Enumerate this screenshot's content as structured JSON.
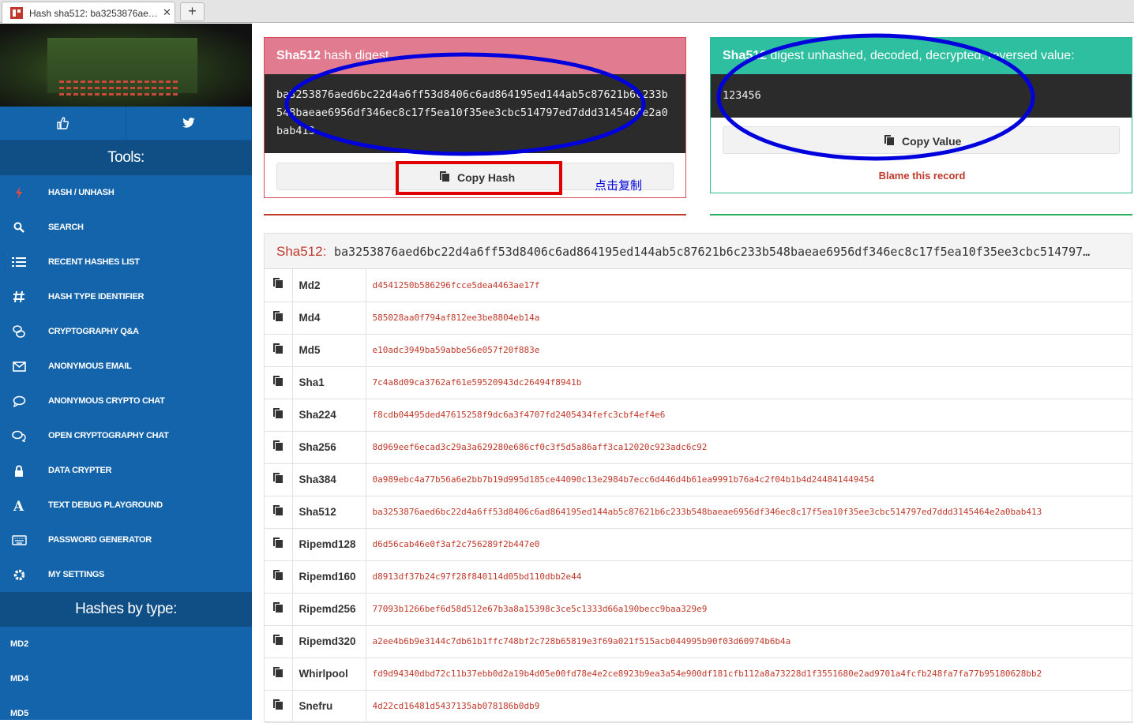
{
  "browser": {
    "tab_title": "Hash sha512: ba3253876ae…",
    "close_glyph": "✕",
    "new_tab_glyph": "+"
  },
  "sidebar": {
    "social": [
      {
        "icon": "thumbs-up-icon"
      },
      {
        "icon": "twitter-icon"
      }
    ],
    "tools_heading": "Tools:",
    "items": [
      {
        "label": "HASH / UNHASH",
        "icon": "bolt-icon"
      },
      {
        "label": "SEARCH",
        "icon": "search-icon"
      },
      {
        "label": "RECENT HASHES LIST",
        "icon": "list-icon"
      },
      {
        "label": "HASH TYPE IDENTIFIER",
        "icon": "hash-icon"
      },
      {
        "label": "CRYPTOGRAPHY Q&A",
        "icon": "qa-icon"
      },
      {
        "label": "ANONYMOUS EMAIL",
        "icon": "envelope-icon"
      },
      {
        "label": "ANONYMOUS CRYPTO CHAT",
        "icon": "chat-bubble-icon"
      },
      {
        "label": "OPEN CRYPTOGRAPHY CHAT",
        "icon": "chat-bubbles-icon"
      },
      {
        "label": "DATA CRYPTER",
        "icon": "lock-icon"
      },
      {
        "label": "TEXT DEBUG PLAYGROUND",
        "icon": "font-icon"
      },
      {
        "label": "PASSWORD GENERATOR",
        "icon": "keyboard-icon"
      },
      {
        "label": "MY SETTINGS",
        "icon": "gear-icon"
      }
    ],
    "types_heading": "Hashes by type:",
    "types": [
      "MD2",
      "MD4",
      "MD5"
    ]
  },
  "digest_card": {
    "head_bold": "Sha512",
    "head_rest": " hash digest",
    "value": "ba3253876aed6bc22d4a6ff53d8406c6ad864195ed144ab5c87621b6c233b548baeae6956df346ec8c17f5ea10f35ee3cbc514797ed7ddd3145464e2a0bab413",
    "copy_label": "Copy Hash",
    "annotation_text": "点击复制"
  },
  "value_card": {
    "head_bold": "Sha512",
    "head_rest": " digest unhashed, decoded, decrypted, reversed value:",
    "value": "123456",
    "copy_label": "Copy Value",
    "blame_label": "Blame this record"
  },
  "results": {
    "head_alg": "Sha512:",
    "head_value": "ba3253876aed6bc22d4a6ff53d8406c6ad864195ed144ab5c87621b6c233b548baeae6956df346ec8c17f5ea10f35ee3cbc514797…",
    "rows": [
      {
        "alg": "Md2",
        "hash": "d4541250b586296fcce5dea4463ae17f"
      },
      {
        "alg": "Md4",
        "hash": "585028aa0f794af812ee3be8804eb14a"
      },
      {
        "alg": "Md5",
        "hash": "e10adc3949ba59abbe56e057f20f883e"
      },
      {
        "alg": "Sha1",
        "hash": "7c4a8d09ca3762af61e59520943dc26494f8941b"
      },
      {
        "alg": "Sha224",
        "hash": "f8cdb04495ded47615258f9dc6a3f4707fd2405434fefc3cbf4ef4e6"
      },
      {
        "alg": "Sha256",
        "hash": "8d969eef6ecad3c29a3a629280e686cf0c3f5d5a86aff3ca12020c923adc6c92"
      },
      {
        "alg": "Sha384",
        "hash": "0a989ebc4a77b56a6e2bb7b19d995d185ce44090c13e2984b7ecc6d446d4b61ea9991b76a4c2f04b1b4d244841449454"
      },
      {
        "alg": "Sha512",
        "hash": "ba3253876aed6bc22d4a6ff53d8406c6ad864195ed144ab5c87621b6c233b548baeae6956df346ec8c17f5ea10f35ee3cbc514797ed7ddd3145464e2a0bab413"
      },
      {
        "alg": "Ripemd128",
        "hash": "d6d56cab46e0f3af2c756289f2b447e0"
      },
      {
        "alg": "Ripemd160",
        "hash": "d8913df37b24c97f28f840114d05bd110dbb2e44"
      },
      {
        "alg": "Ripemd256",
        "hash": "77093b1266bef6d58d512e67b3a8a15398c3ce5c1333d66a190becc9baa329e9"
      },
      {
        "alg": "Ripemd320",
        "hash": "a2ee4b6b9e3144c7db61b1ffc748bf2c728b65819e3f69a021f515acb044995b90f03d60974b6b4a"
      },
      {
        "alg": "Whirlpool",
        "hash": "fd9d94340dbd72c11b37ebb0d2a19b4d05e00fd78e4e2ce8923b9ea3a54e900df181cfb112a8a73228d1f3551680e2ad9701a4fcfb248fa7fa77b95180628bb2"
      },
      {
        "alg": "Snefru",
        "hash": "4d22cd16481d5437135ab078186b0db9"
      }
    ]
  },
  "colors": {
    "sidebar_blue": "#1464ab",
    "accent_red": "#c0392b",
    "accent_green": "#2dbfa0",
    "annotation_blue": "#0000dd",
    "annotation_red": "#e00000"
  }
}
